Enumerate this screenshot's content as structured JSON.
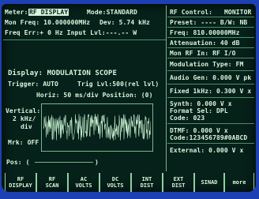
{
  "top": {
    "meter_label": "Meter:",
    "meter_value": "RF DISPLAY",
    "mode": "Mode:STANDARD",
    "mon_freq": "Mon Freq:  10.000000MHz",
    "dev": "Dev:  5.74 kHz",
    "freq_err": "Freq Err:+    0 Hz Input Lvl:---.-- W"
  },
  "right": {
    "rf_control_label": "RF Control:",
    "rf_control_value": "MONITOR",
    "preset": "Preset:  ----  B/W: NB",
    "freq": "Freq:   810.00000MHz",
    "attenuation": "Attenuation:   40 dB",
    "mon_rf_in": "Mon RF In:     RF I/O",
    "modulation_type": "Modulation Type:   FM",
    "audio_gen": "Audio Gen:  0.000 V pk",
    "fixed": "Fixed 1kHz: 0.300 V  x",
    "synth": "Synth:      0.000 V  x",
    "format_sel": "Format Sel:       DPL",
    "code": "Code:              023",
    "dtmf": "DTMF:       0.000 V  x",
    "dtmf_code": "Code:123456789#0ABCD",
    "external": "External:   0.000 V  x"
  },
  "scope": {
    "display": "Display: MODULATION SCOPE",
    "trigger": "Trigger: AUTO",
    "trig_lvl": "Trig Lvl:500(rel lvl)",
    "horiz": "Horiz:  50 ms/div  Position: (0)",
    "vertical": "Vertical:",
    "vertical_value": "2 kHz/",
    "vertical_unit": "div",
    "mrk": "Mrk: OFF",
    "pos": "Pos: (",
    "pos_end": ")"
  },
  "softkeys": [
    {
      "line1": "RF",
      "line2": "DISPLAY"
    },
    {
      "line1": "RF",
      "line2": "SCAN"
    },
    {
      "line1": "AC",
      "line2": "VOLTS"
    },
    {
      "line1": "DC",
      "line2": "VOLTS"
    },
    {
      "line1": "INT",
      "line2": "DIST"
    },
    {
      "line1": "EXT",
      "line2": "DIST"
    },
    {
      "line1": "SINAD",
      "line2": ""
    },
    {
      "line1": "more",
      "line2": ""
    }
  ],
  "colors": {
    "screen": "#06201a",
    "phosphor": "#d8f5dc",
    "bezel": "#1e40b5"
  }
}
